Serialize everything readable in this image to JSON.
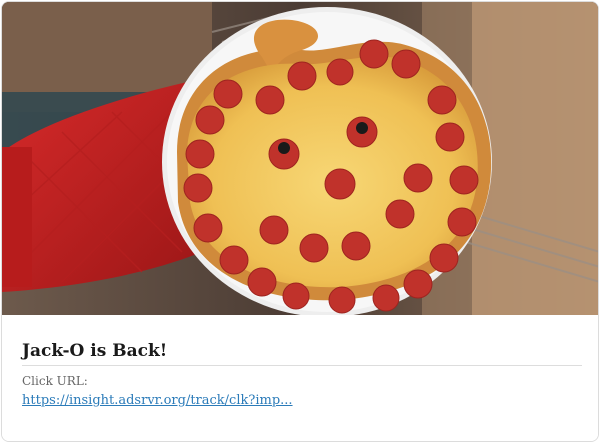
{
  "ad": {
    "image_alt": "Jack-O pumpkin-shaped pepperoni pizza coming out of the oven",
    "title": "Jack-O is Back!",
    "click_url_label": "Click URL:",
    "click_url_text": "https://insight.adsrvr.org/track/clk?imp..."
  },
  "colors": {
    "link": "#2b7bb9",
    "title": "#1a1a1a",
    "label": "#666666"
  }
}
